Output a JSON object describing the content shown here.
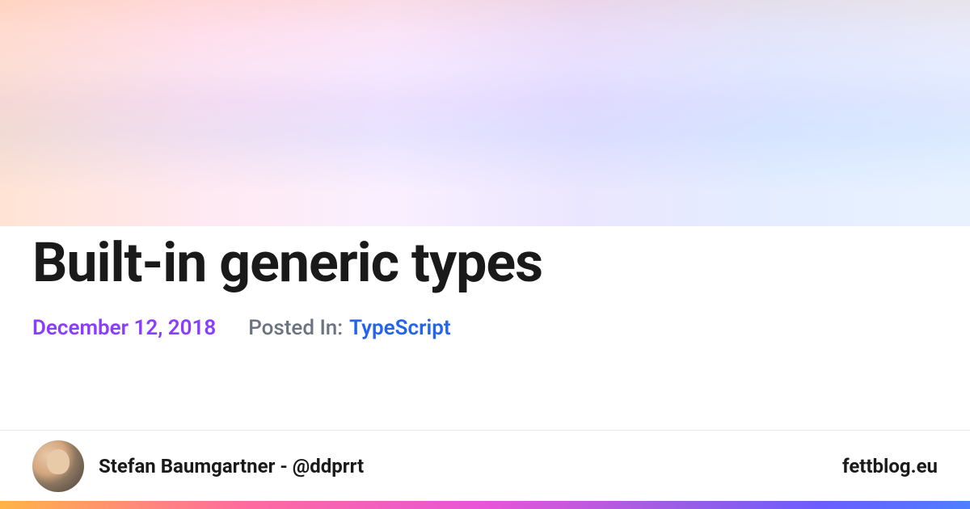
{
  "title": "Built-in generic types",
  "date": "December 12, 2018",
  "posted_in_label": "Posted In:",
  "category": "TypeScript",
  "author": {
    "name_handle": "Stefan Baumgartner - @ddprrt"
  },
  "site": "fettblog.eu"
}
